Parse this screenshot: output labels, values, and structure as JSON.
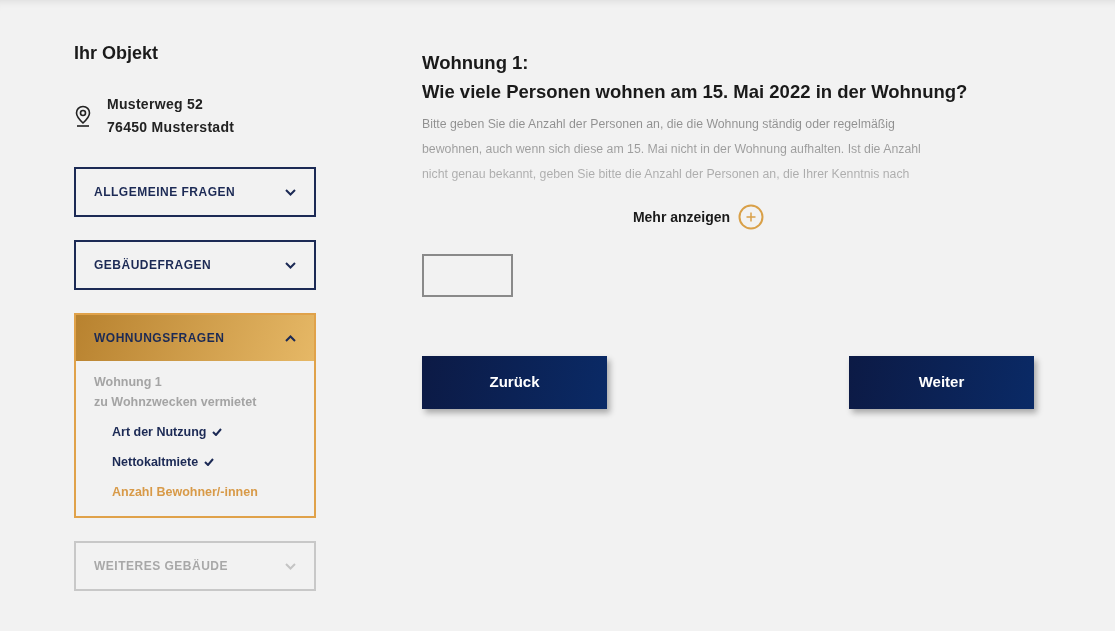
{
  "sidebar": {
    "title": "Ihr Objekt",
    "address": [
      "Musterweg 52",
      "76450 Musterstadt"
    ],
    "sections": [
      {
        "label": "ALLGEMEINE FRAGEN",
        "expanded": false,
        "disabled": false
      },
      {
        "label": "GEBÄUDEFRAGEN",
        "expanded": false,
        "disabled": false
      },
      {
        "label": "WOHNUNGSFRAGEN",
        "expanded": true,
        "disabled": false,
        "group": [
          "Wohnung 1",
          "zu Wohnzwecken vermietet"
        ],
        "items": [
          {
            "label": "Art der Nutzung",
            "checked": true,
            "selected": false
          },
          {
            "label": "Nettokaltmiete",
            "checked": true,
            "selected": false
          },
          {
            "label": "Anzahl Bewohner/-innen",
            "checked": false,
            "selected": true
          }
        ]
      },
      {
        "label": "WEITERES GEBÄUDE",
        "expanded": false,
        "disabled": true
      }
    ]
  },
  "question": {
    "title": [
      "Wohnung 1:",
      "Wie viele Personen wohnen am 15. Mai 2022 in der Wohnung?"
    ],
    "description": [
      "Bitte geben Sie die Anzahl der Personen an, die die Wohnung ständig oder regelmäßig",
      "bewohnen, auch wenn sich diese am 15. Mai nicht in der Wohnung aufhalten. Ist die Anzahl",
      "nicht genau bekannt, geben Sie bitte die Anzahl der Personen an, die Ihrer Kenntnis nach"
    ],
    "more": "Mehr anzeigen"
  },
  "buttons": [
    "Zurück",
    "Weiter"
  ]
}
